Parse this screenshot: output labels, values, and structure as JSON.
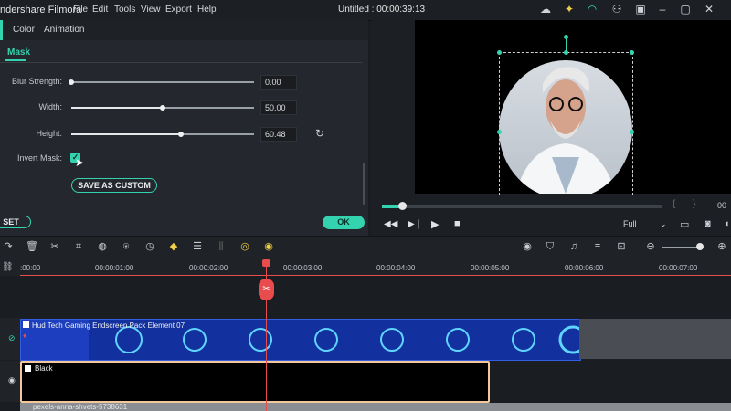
{
  "menu": {
    "app_name": "ndershare Filmora",
    "items": [
      "File",
      "Edit",
      "Tools",
      "View",
      "Export",
      "Help"
    ],
    "project_title": "Untitled : 00:00:39:13"
  },
  "tabs": {
    "color": "Color",
    "animation": "Animation",
    "mask": "Mask"
  },
  "mask": {
    "blur_label": "Blur Strength:",
    "blur_value": "0.00",
    "blur_level": 0.0,
    "width_label": "Width:",
    "width_value": "50.00",
    "width_level": 0.5,
    "height_label": "Height:",
    "height_value": "60.48",
    "height_level": 0.6,
    "invert_label": "Invert Mask:",
    "save_custom": "SAVE AS CUSTOM"
  },
  "buttons": {
    "reset": "SET",
    "ok": "OK"
  },
  "player": {
    "quality": "Full",
    "time_frag": "00"
  },
  "ruler": {
    "ticks": [
      ":00:00",
      "00:00:01:00",
      "00:00:02:00",
      "00:00:03:00",
      "00:00:04:00",
      "00:00:05:00",
      "00:00:06:00",
      "00:00:07:00"
    ]
  },
  "tracks": {
    "clip1": "Hud Tech Gaming Endscreen Pack Element 07",
    "clip2": "Black",
    "clip3": "pexels-anna-shvets-5738631"
  },
  "colors": {
    "accent": "#34d3b0",
    "playhead": "#e84c4c",
    "clip_blue": "#1d3fbf",
    "selected_border": "#f3c79b"
  }
}
